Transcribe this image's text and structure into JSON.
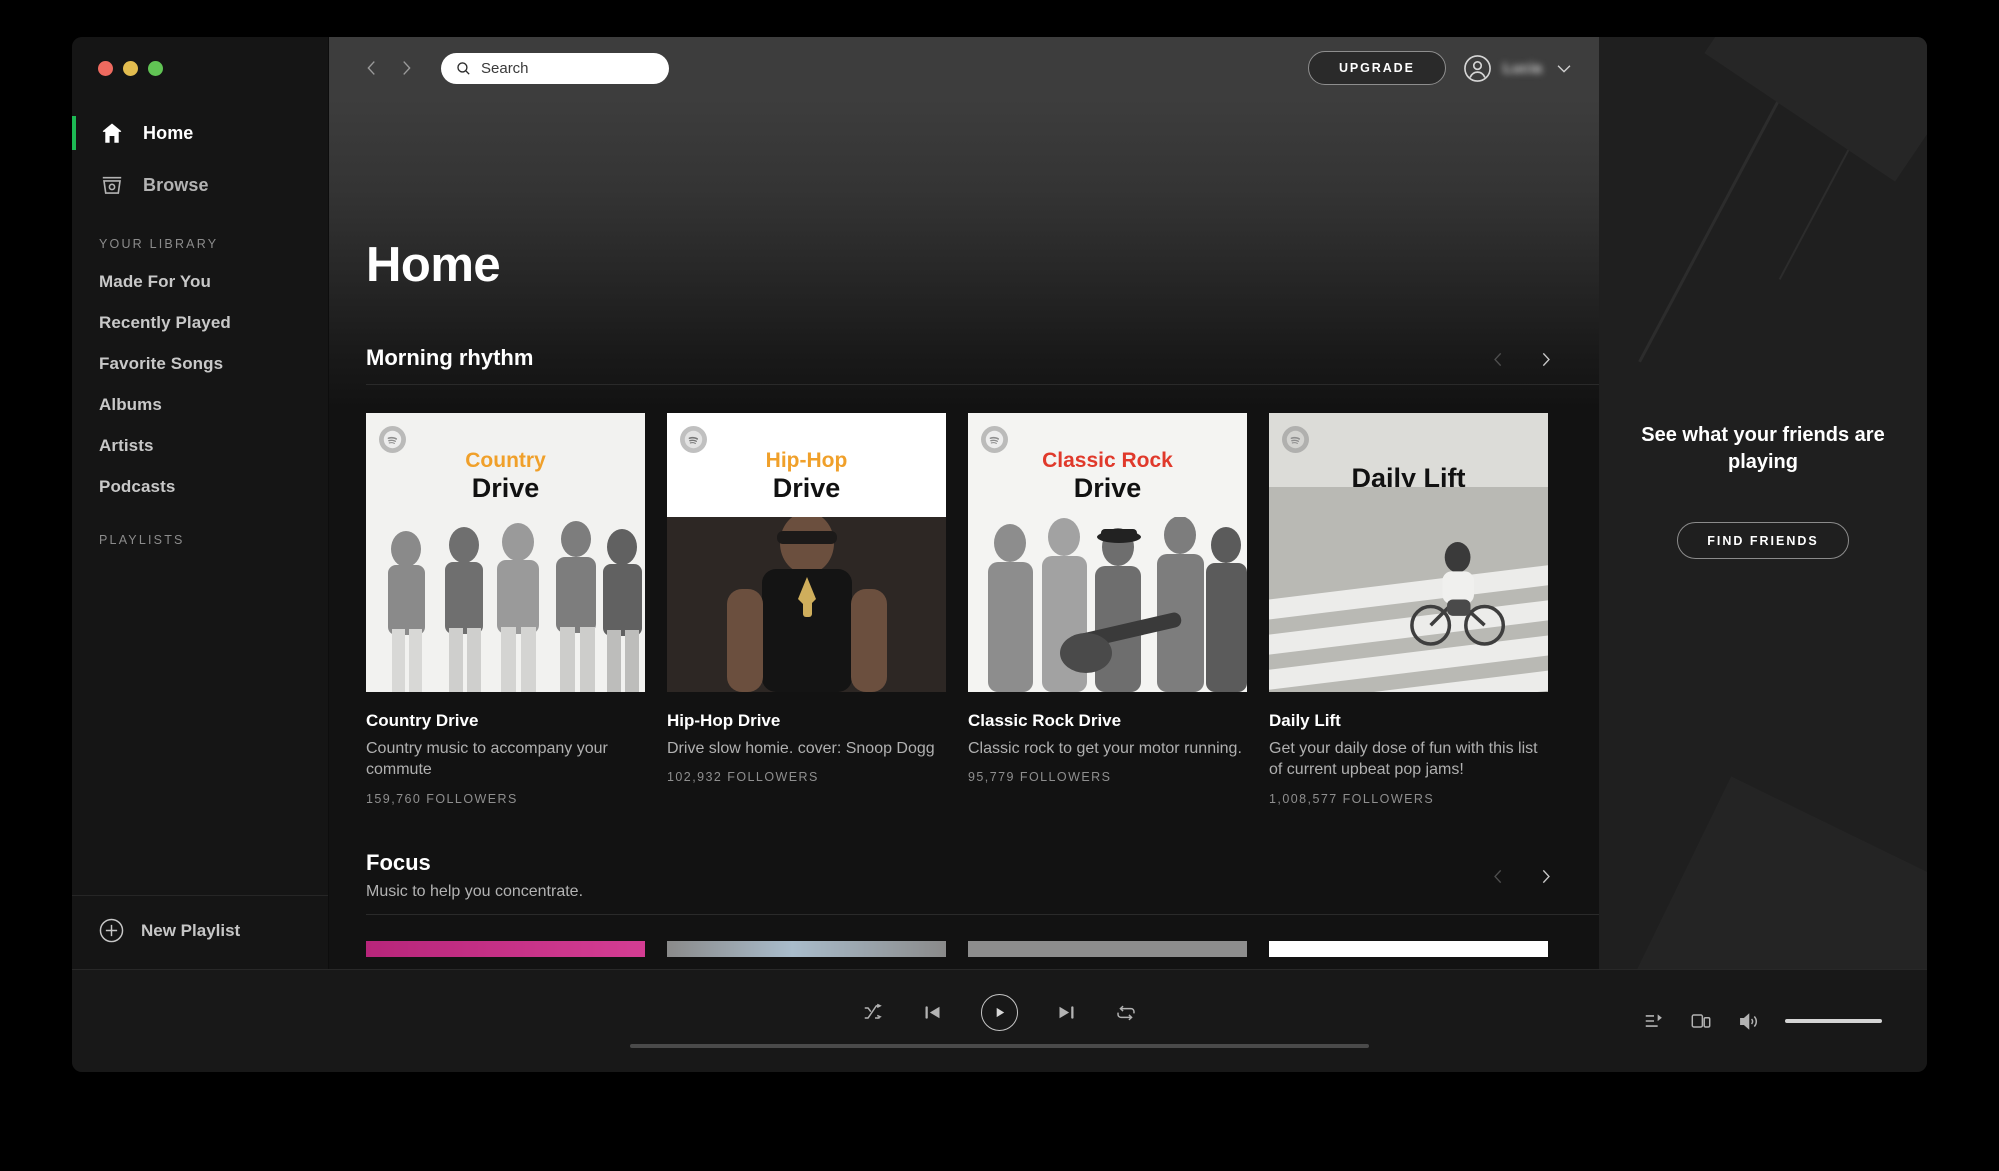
{
  "window": {
    "traffic_lights": [
      {
        "name": "close",
        "color": "#ee6a5f"
      },
      {
        "name": "minimize",
        "color": "#e2bc4f"
      },
      {
        "name": "maximize",
        "color": "#61c454"
      }
    ]
  },
  "sidebar": {
    "primary_nav": [
      {
        "label": "Home",
        "icon": "home-icon",
        "active": true
      },
      {
        "label": "Browse",
        "icon": "browse-icon",
        "active": false
      }
    ],
    "library_heading": "YOUR LIBRARY",
    "library_items": [
      {
        "label": "Made For You"
      },
      {
        "label": "Recently Played"
      },
      {
        "label": "Favorite Songs"
      },
      {
        "label": "Albums"
      },
      {
        "label": "Artists"
      },
      {
        "label": "Podcasts"
      }
    ],
    "playlists_heading": "PLAYLISTS",
    "playlists": [],
    "new_playlist_label": "New Playlist",
    "active_accent": "#1db954"
  },
  "topbar": {
    "back_icon": "chevron-left-icon",
    "forward_icon": "chevron-right-icon",
    "search": {
      "icon": "search-icon",
      "placeholder": "Search",
      "value": ""
    },
    "upgrade_label": "UPGRADE",
    "avatar_icon": "user-avatar-icon",
    "username": "Lucia",
    "dropdown_icon": "chevron-down-icon"
  },
  "main": {
    "page_title": "Home",
    "shelves": [
      {
        "title": "Morning rhythm",
        "subtitle": "",
        "prev_enabled": false,
        "next_enabled": true,
        "cards": [
          {
            "title": "Country Drive",
            "description": "Country music to accompany your commute",
            "followers": "159,760 FOLLOWERS",
            "art_kicker": "Country",
            "art_kicker_color": "#f0a02a",
            "art_main": "Drive",
            "art_bg": "#f2f2f0"
          },
          {
            "title": "Hip-Hop Drive",
            "description": "Drive slow homie. cover: Snoop Dogg",
            "followers": "102,932 FOLLOWERS",
            "art_kicker": "Hip-Hop",
            "art_kicker_color": "#f0a02a",
            "art_main": "Drive",
            "art_bg": "#ffffff"
          },
          {
            "title": "Classic Rock Drive",
            "description": "Classic rock to get your motor running.",
            "followers": "95,779 FOLLOWERS",
            "art_kicker": "Classic Rock",
            "art_kicker_color": "#e0392b",
            "art_main": "Drive",
            "art_bg": "#f4f4f2"
          },
          {
            "title": "Daily Lift",
            "description": "Get your daily dose of fun with this list of current upbeat pop jams!",
            "followers": "1,008,577 FOLLOWERS",
            "art_kicker": "",
            "art_kicker_color": "#111111",
            "art_main": "Daily Lift",
            "art_bg": "#dcdcd8"
          }
        ]
      },
      {
        "title": "Focus",
        "subtitle": "Music to help you concentrate.",
        "prev_enabled": false,
        "next_enabled": true,
        "cards": [
          {
            "art_bg": "#c9267f"
          },
          {
            "art_bg": "#8fa4b4"
          },
          {
            "art_bg": "#8d8d8d"
          },
          {
            "art_bg": "#ffffff"
          }
        ]
      }
    ]
  },
  "friends_panel": {
    "title": "See what your friends are playing",
    "button_label": "FIND FRIENDS"
  },
  "player": {
    "shuffle_icon": "shuffle-icon",
    "previous_icon": "previous-track-icon",
    "play_icon": "play-icon",
    "next_icon": "next-track-icon",
    "repeat_icon": "repeat-icon",
    "progress_percent": 0,
    "queue_icon": "queue-icon",
    "devices_icon": "connect-device-icon",
    "volume_icon": "volume-icon",
    "volume_percent": 100
  }
}
